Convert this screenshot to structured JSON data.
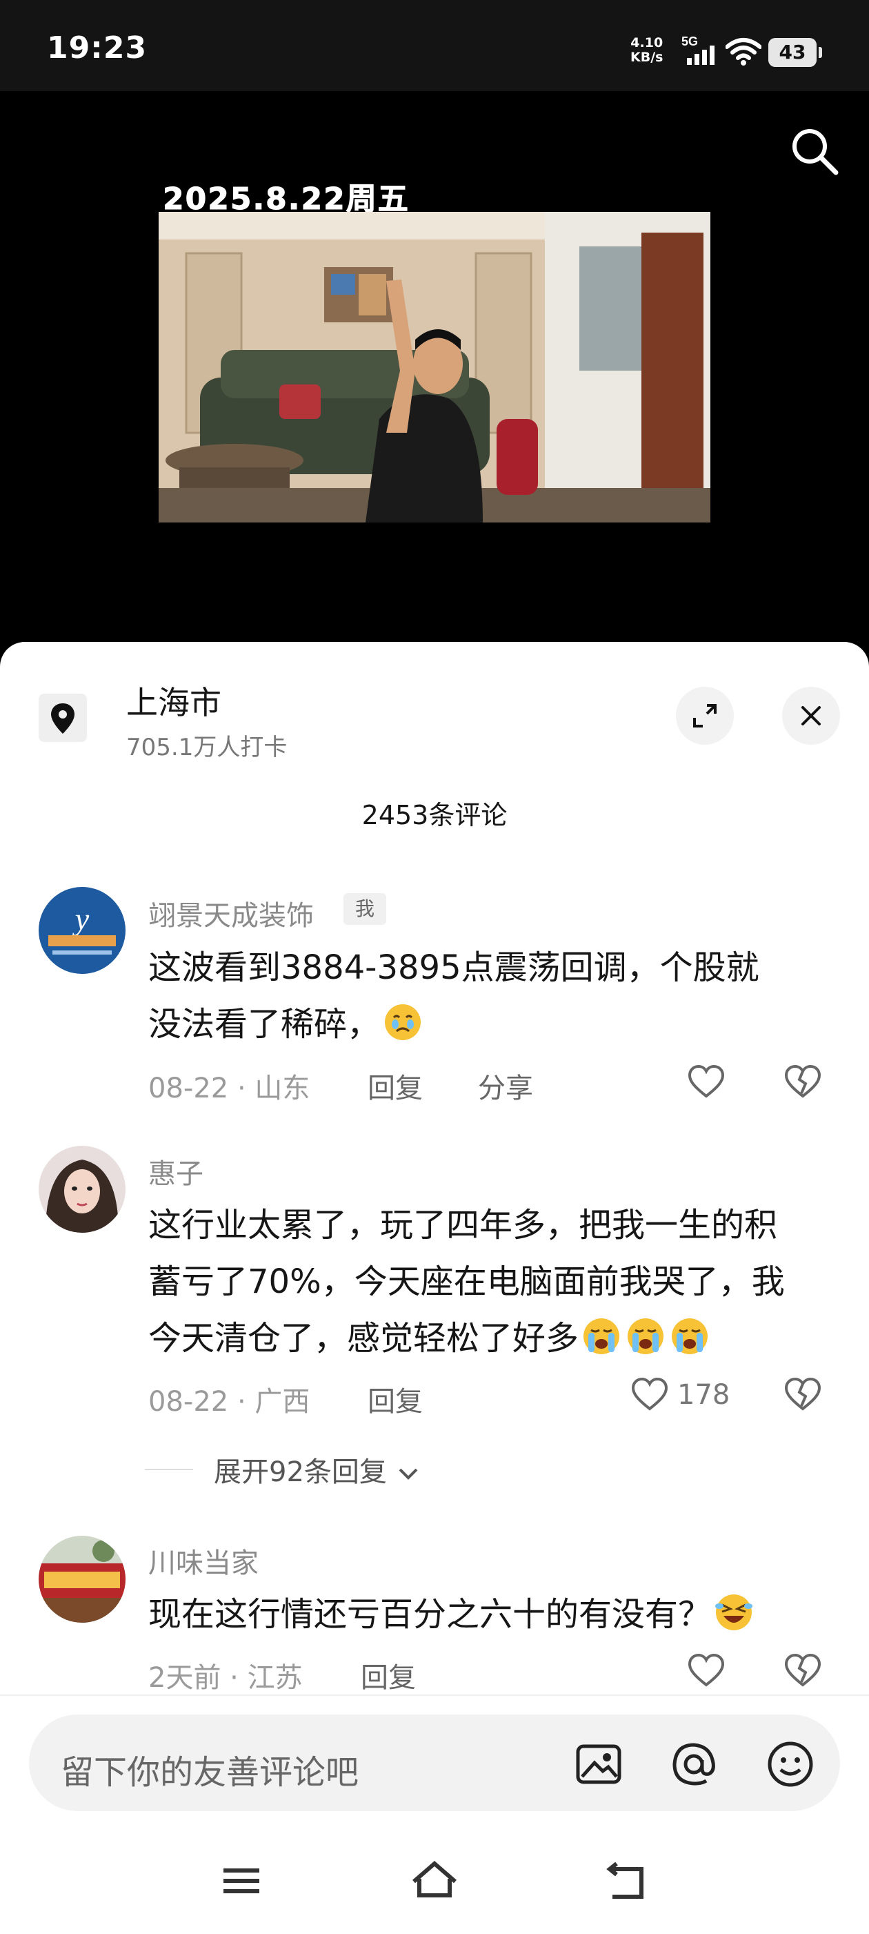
{
  "status_bar": {
    "time": "19:23",
    "net_speed_value": "4.10",
    "net_speed_unit": "KB/s",
    "network": "5G",
    "battery": "43"
  },
  "video": {
    "date_overlay": "2025.8.22周五"
  },
  "location": {
    "name": "上海市",
    "checkins": "705.1万人打卡"
  },
  "comments_header": {
    "count_label": "2453条评论"
  },
  "comments": [
    {
      "user": "翊景天成装饰",
      "tag": "我",
      "text_line1": "这波看到3884-3895点震荡回调，个股就",
      "text_line2": "没法看了稀碎，",
      "date": "08-22",
      "region": "山东",
      "reply_label": "回复",
      "share_label": "分享",
      "dot": "·"
    },
    {
      "user": "惠子",
      "text_line1": "这行业太累了，玩了四年多，把我一生的积",
      "text_line2": "蓄亏了70%，今天座在电脑面前我哭了，我",
      "text_line3": "今天清仓了，感觉轻松了好多",
      "date": "08-22",
      "region": "广西",
      "reply_label": "回复",
      "likes": "178",
      "dot": "·",
      "expand_label": "展开92条回复"
    },
    {
      "user": "川味当家",
      "text_line1": "现在这行情还亏百分之六十的有没有？",
      "date": "2天前",
      "region": "江苏",
      "reply_label": "回复",
      "dot": "·"
    }
  ],
  "input": {
    "placeholder": "留下你的友善评论吧"
  },
  "icons": {
    "search": "search-icon",
    "location": "location-pin-icon",
    "expand": "expand-icon",
    "close": "close-icon",
    "like": "heart-icon",
    "dislike": "broken-heart-icon",
    "image": "image-icon",
    "at": "at-icon",
    "emoji": "emoji-icon",
    "menu": "menu-icon",
    "home": "home-icon",
    "back": "back-icon"
  },
  "colors": {
    "background": "#000000",
    "sheet": "#ffffff",
    "text": "#161616",
    "meta": "#9a9a9a"
  }
}
